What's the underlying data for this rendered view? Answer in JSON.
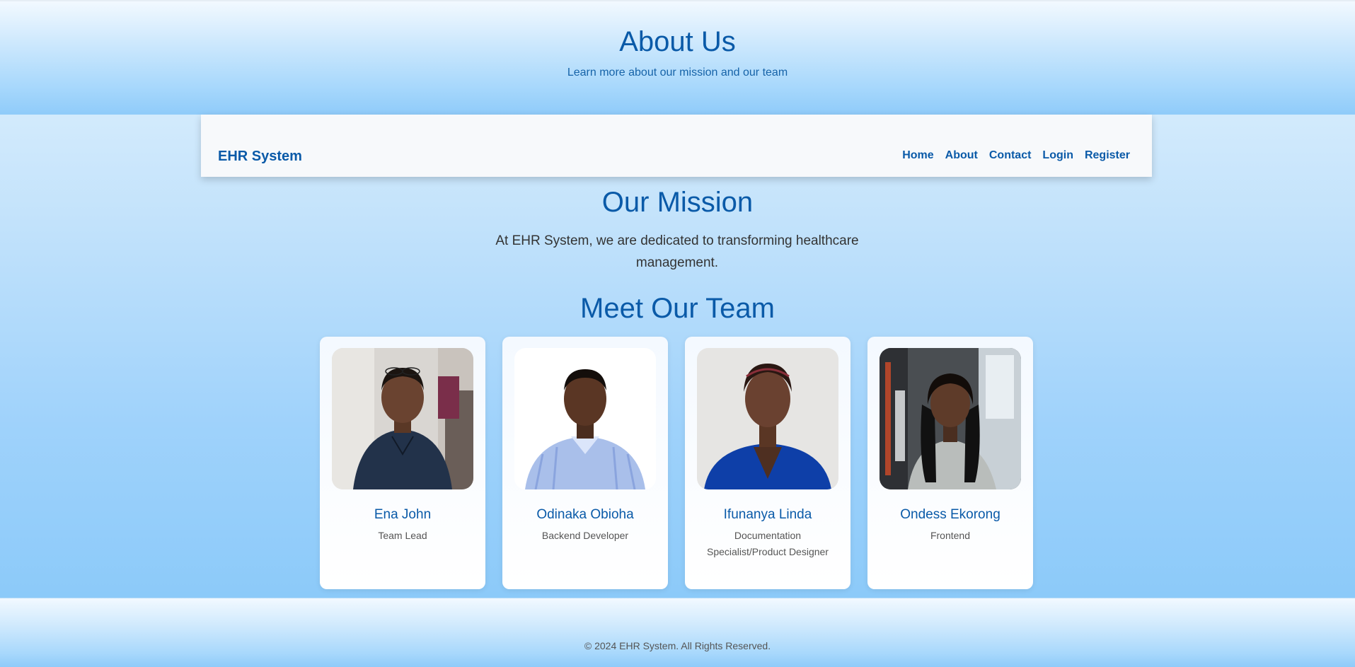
{
  "header": {
    "title": "About Us",
    "subtitle": "Learn more about our mission and our team"
  },
  "navbar": {
    "brand": "EHR System",
    "links": [
      {
        "label": "Home"
      },
      {
        "label": "About"
      },
      {
        "label": "Contact"
      },
      {
        "label": "Login"
      },
      {
        "label": "Register"
      }
    ]
  },
  "mission": {
    "title": "Our Mission",
    "text": "At EHR System, we are dedicated to transforming healthcare management."
  },
  "team": {
    "title": "Meet Our Team",
    "members": [
      {
        "name": "Ena John",
        "role": "Team Lead",
        "photo": "portrait-man-dark-shirt"
      },
      {
        "name": "Odinaka Obioha",
        "role": "Backend Developer",
        "photo": "portrait-man-striped-shirt"
      },
      {
        "name": "Ifunanya Linda",
        "role": "Documentation Specialist/Product Designer",
        "photo": "portrait-woman-blue-blazer"
      },
      {
        "name": "Ondess Ekorong",
        "role": "Frontend",
        "photo": "portrait-woman-grey-top"
      }
    ]
  },
  "footer": {
    "text": "© 2024 EHR System. All Rights Reserved."
  },
  "colors": {
    "accent": "#0a5aa8",
    "background": "#c4e3fb",
    "card": "#ffffff"
  }
}
